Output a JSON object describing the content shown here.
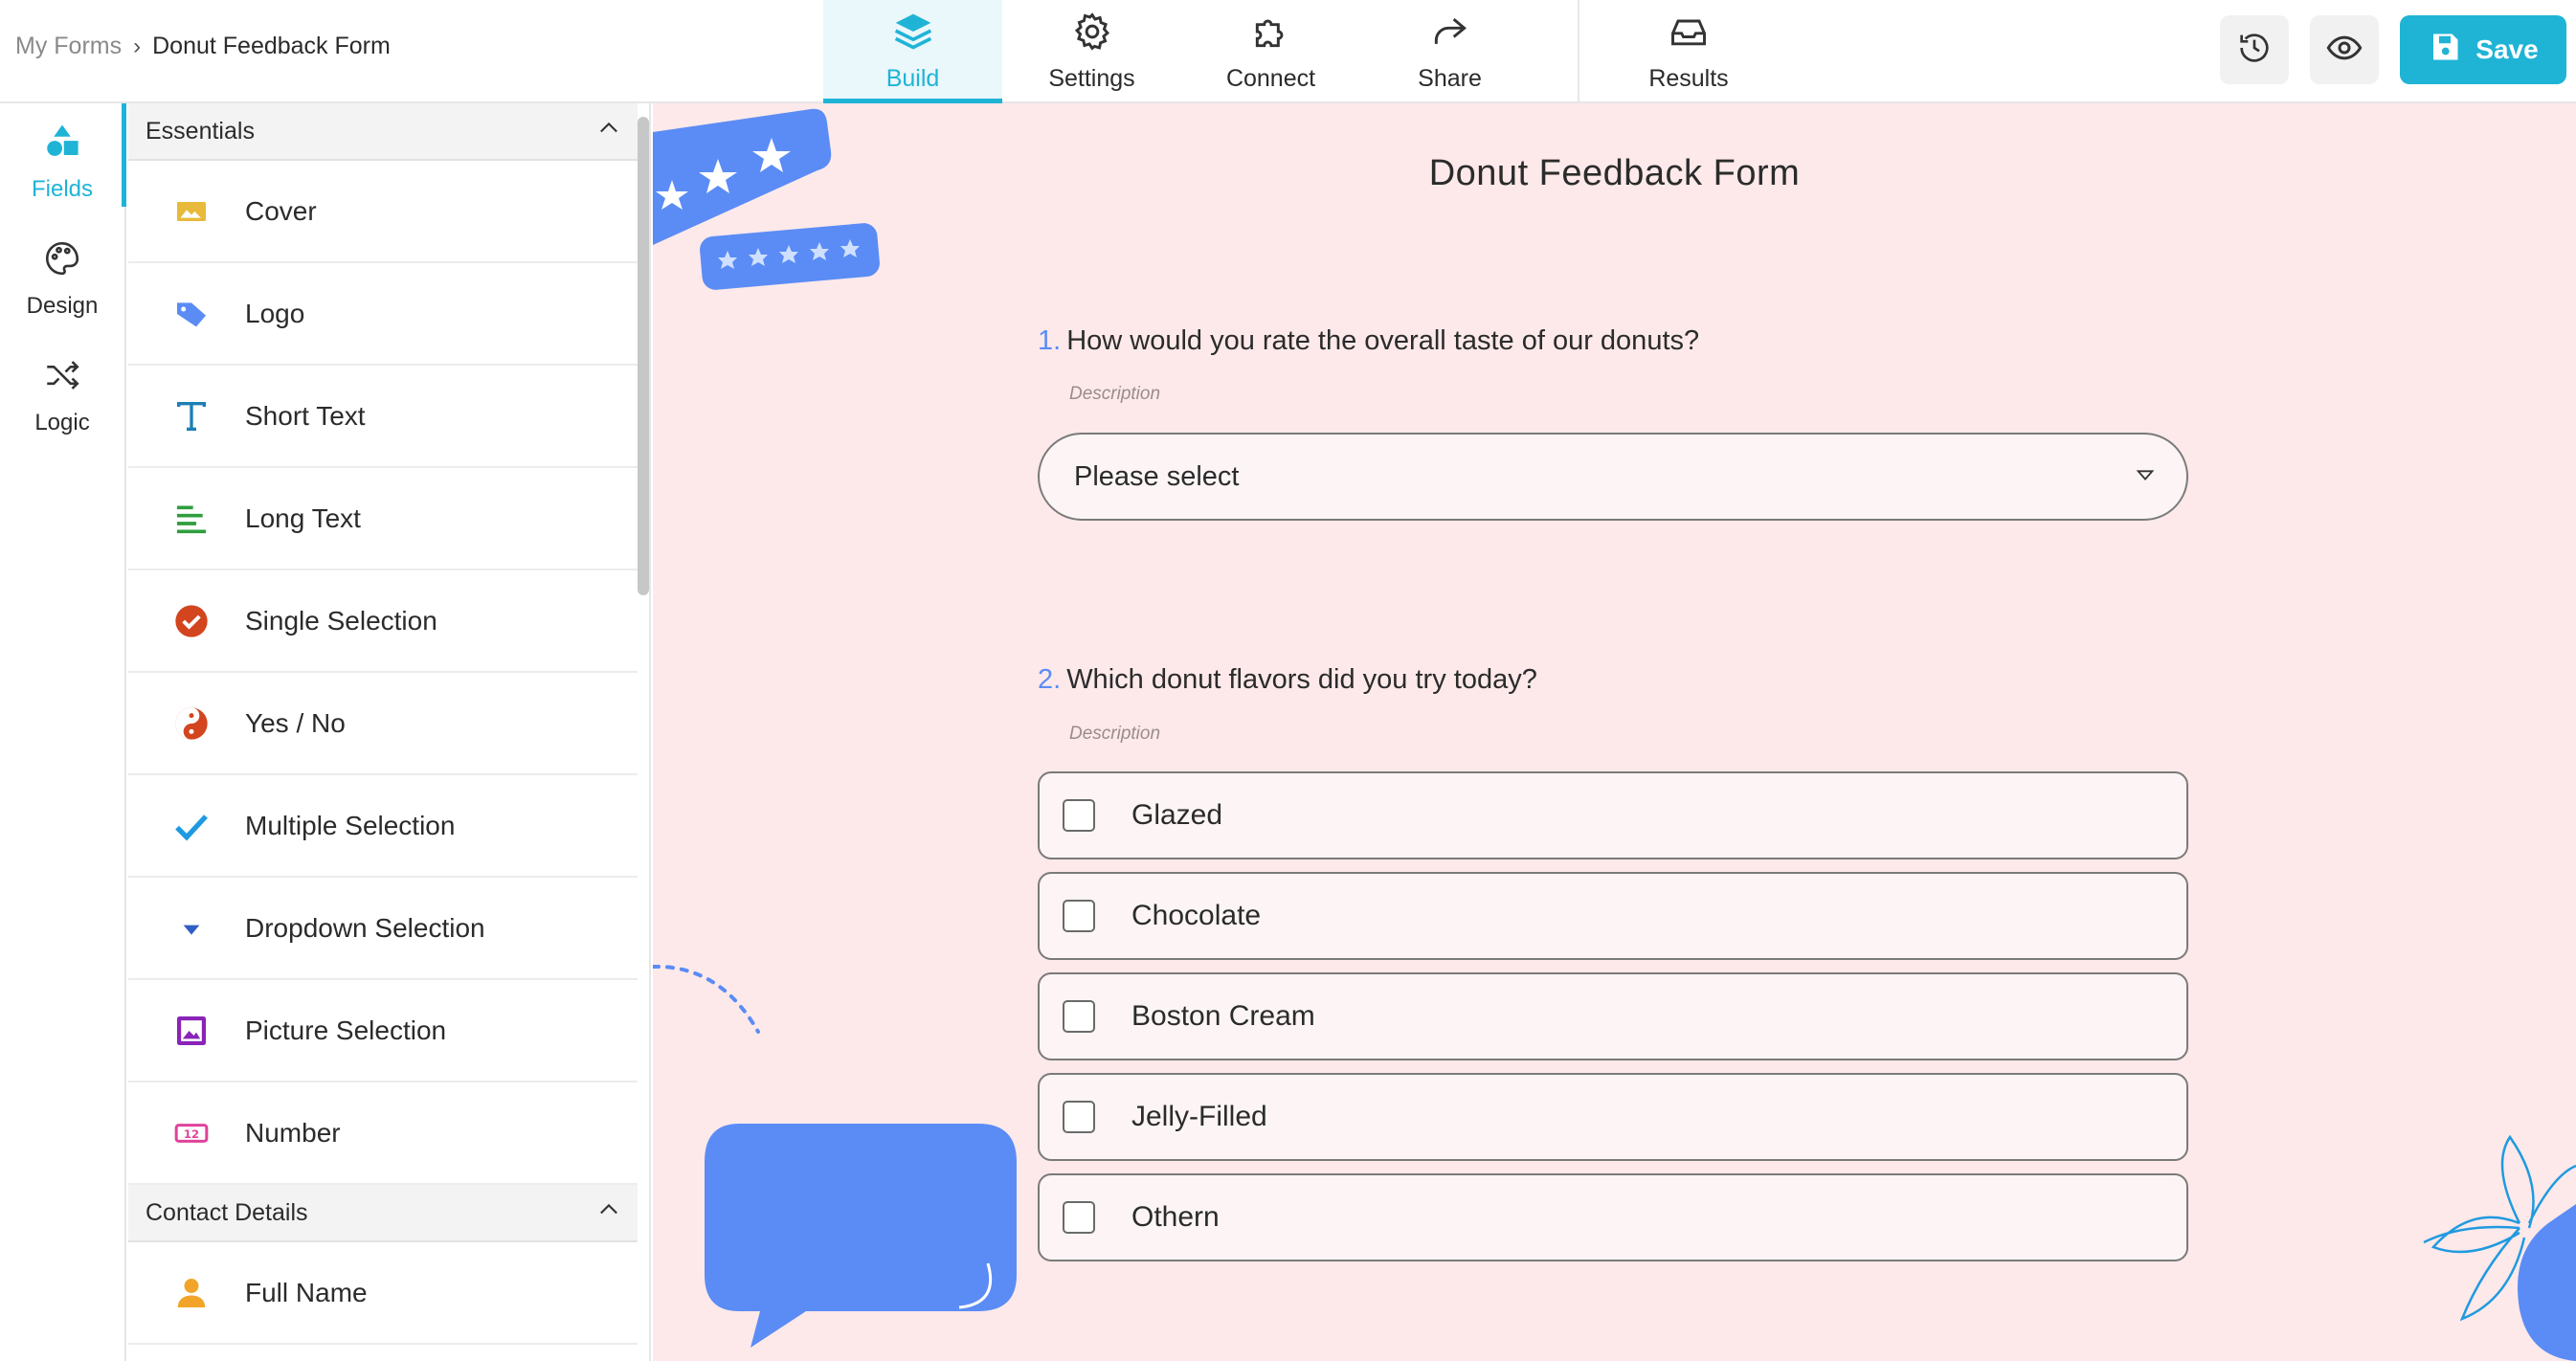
{
  "breadcrumb": {
    "root": "My Forms",
    "separator": "›",
    "current": "Donut Feedback Form"
  },
  "nav": {
    "tabs": [
      {
        "label": "Build",
        "icon": "layers-icon"
      },
      {
        "label": "Settings",
        "icon": "gear-icon"
      },
      {
        "label": "Connect",
        "icon": "puzzle-icon"
      },
      {
        "label": "Share",
        "icon": "share-arrow-icon"
      },
      {
        "label": "Results",
        "icon": "inbox-icon"
      }
    ],
    "active_tab": "Build"
  },
  "toolbar": {
    "history_icon": "history-icon",
    "preview_icon": "eye-icon",
    "save_label": "Save"
  },
  "rail": {
    "items": [
      {
        "label": "Fields",
        "icon": "shapes-icon"
      },
      {
        "label": "Design",
        "icon": "palette-icon"
      },
      {
        "label": "Logic",
        "icon": "shuffle-icon"
      }
    ],
    "active": "Fields"
  },
  "panel": {
    "sections": [
      {
        "title": "Essentials",
        "items": [
          {
            "label": "Cover",
            "icon": "image-icon",
            "color": "#e8b93a"
          },
          {
            "label": "Logo",
            "icon": "tag-icon",
            "color": "#5b8cf5"
          },
          {
            "label": "Short Text",
            "icon": "text-t-icon",
            "color": "#1c7fb8"
          },
          {
            "label": "Long Text",
            "icon": "paragraph-icon",
            "color": "#2e9e3e"
          },
          {
            "label": "Single Selection",
            "icon": "check-circle-icon",
            "color": "#d2451e"
          },
          {
            "label": "Yes / No",
            "icon": "yin-yang-icon",
            "color": "#d2451e"
          },
          {
            "label": "Multiple Selection",
            "icon": "checkmark-icon",
            "color": "#1f9ae0"
          },
          {
            "label": "Dropdown Selection",
            "icon": "caret-down-icon",
            "color": "#2f5ec4"
          },
          {
            "label": "Picture Selection",
            "icon": "picture-icon",
            "color": "#8a24b8"
          },
          {
            "label": "Number",
            "icon": "number-icon",
            "color": "#e0429a"
          }
        ]
      },
      {
        "title": "Contact Details",
        "items": [
          {
            "label": "Full Name",
            "icon": "person-icon",
            "color": "#f2a42a"
          }
        ]
      }
    ]
  },
  "form": {
    "title": "Donut Feedback Form",
    "questions": [
      {
        "number": "1.",
        "text": "How would you rate the overall taste of our donuts?",
        "description": "Description",
        "placeholder": "Please select"
      },
      {
        "number": "2.",
        "text": "Which donut flavors did you try today?",
        "description": "Description",
        "options": [
          "Glazed",
          "Chocolate",
          "Boston Cream",
          "Jelly-Filled",
          "Othern"
        ]
      }
    ]
  },
  "colors": {
    "accent": "#1fb4d6",
    "canvas_bg": "#fde9ea",
    "question_number": "#5b8cf5",
    "decoration_blue": "#5b8cf5"
  }
}
